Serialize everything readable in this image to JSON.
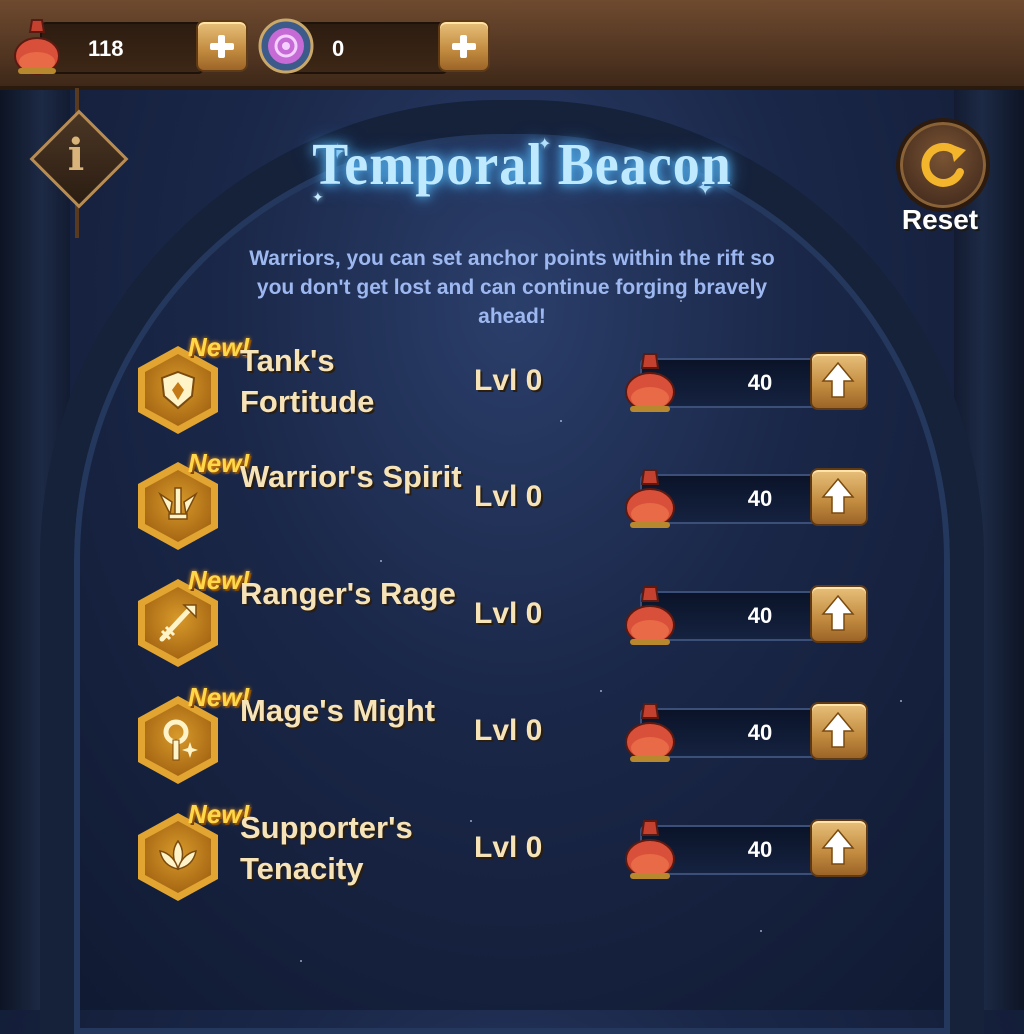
{
  "currencies": [
    {
      "icon": "potion-icon",
      "value": "118"
    },
    {
      "icon": "dream-orb-icon",
      "value": "0"
    }
  ],
  "title": "Temporal Beacon",
  "reset_label": "Reset",
  "description": "Warriors, you can set anchor points within the rift so you don't get lost and can continue forging bravely ahead!",
  "skills": [
    {
      "name": "Tank's Fortitude",
      "badge": "New!",
      "level": "Lvl 0",
      "cost": "40",
      "icon": "shield-icon"
    },
    {
      "name": "Warrior's Spirit",
      "badge": "New!",
      "level": "Lvl 0",
      "cost": "40",
      "icon": "sword-wings-icon"
    },
    {
      "name": "Ranger's Rage",
      "badge": "New!",
      "level": "Lvl 0",
      "cost": "40",
      "icon": "arrow-icon"
    },
    {
      "name": "Mage's Might",
      "badge": "New!",
      "level": "Lvl 0",
      "cost": "40",
      "icon": "staff-icon"
    },
    {
      "name": "Supporter's Tenacity",
      "badge": "New!",
      "level": "Lvl 0",
      "cost": "40",
      "icon": "lotus-icon"
    }
  ],
  "colors": {
    "accent_gold": "#e2a531",
    "title_glow": "#bfe9ff",
    "text_cream": "#f6e3b8",
    "description_blue": "#9db8f0"
  }
}
